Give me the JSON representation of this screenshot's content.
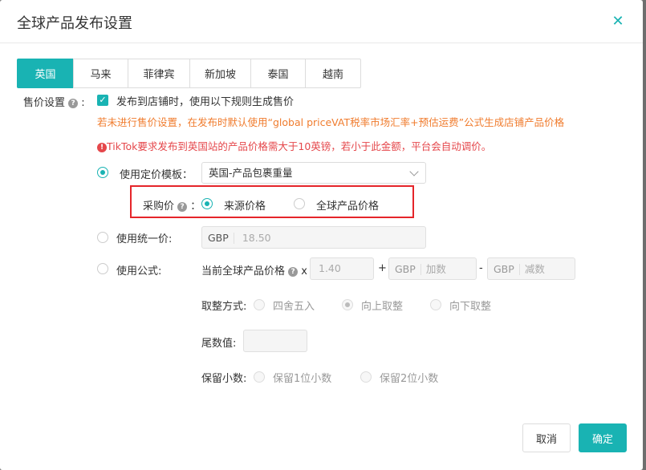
{
  "dialog": {
    "title": "全球产品发布设置",
    "close_icon": "close-icon"
  },
  "tabs": [
    {
      "label": "英国",
      "active": true
    },
    {
      "label": "马来",
      "active": false
    },
    {
      "label": "菲律宾",
      "active": false
    },
    {
      "label": "新加坡",
      "active": false
    },
    {
      "label": "泰国",
      "active": false
    },
    {
      "label": "越南",
      "active": false
    }
  ],
  "pricing": {
    "label": "售价设置",
    "help_icon": "?",
    "colon": ":",
    "publish_checkbox_label": "发布到店铺时，使用以下规则生成售价",
    "publish_checked": true,
    "warning_orange": "若未进行售价设置，在发布时默认使用“global priceVAT税率市场汇率+预估运费”公式生成店铺产品价格",
    "warning_red": "TikTok要求发布到英国站的产品价格需大于10英镑，若小于此金额，平台会自动调价。",
    "warning_red_icon": "!",
    "template_option": {
      "label": "使用定价模板：",
      "selected": true,
      "select_value": "英国-产品包裹重量"
    },
    "purchase_price": {
      "label": "采购价",
      "help_icon": "?",
      "colon": "：",
      "options": [
        {
          "label": "来源价格",
          "selected": true
        },
        {
          "label": "全球产品价格",
          "selected": false
        }
      ]
    },
    "unified_option": {
      "label": "使用统一价:",
      "selected": false,
      "currency": "GBP",
      "value": "18.50"
    },
    "formula_option": {
      "label": "使用公式:",
      "selected": false,
      "current_price_label": "当前全球产品价格",
      "help_icon": "?",
      "multiply": "x",
      "multiplier": "1.40",
      "plus": "+",
      "add_currency": "GBP",
      "add_placeholder": "加数",
      "minus": "-",
      "sub_currency": "GBP",
      "sub_placeholder": "减数"
    },
    "rounding": {
      "label": "取整方式:",
      "options": [
        {
          "label": "四舍五入",
          "selected": false
        },
        {
          "label": "向上取整",
          "selected": true
        },
        {
          "label": "向下取整",
          "selected": false
        }
      ]
    },
    "tail_value": {
      "label": "尾数值:",
      "value": ""
    },
    "decimals": {
      "label": "保留小数:",
      "options": [
        {
          "label": "保留1位小数",
          "selected": false
        },
        {
          "label": "保留2位小数",
          "selected": false
        }
      ]
    }
  },
  "footer": {
    "cancel_label": "取消",
    "ok_label": "确定"
  },
  "colors": {
    "accent": "#19b3b3",
    "warning_orange": "#f07c2e",
    "warning_red": "#e5474b",
    "highlight_box": "#e5252a"
  }
}
